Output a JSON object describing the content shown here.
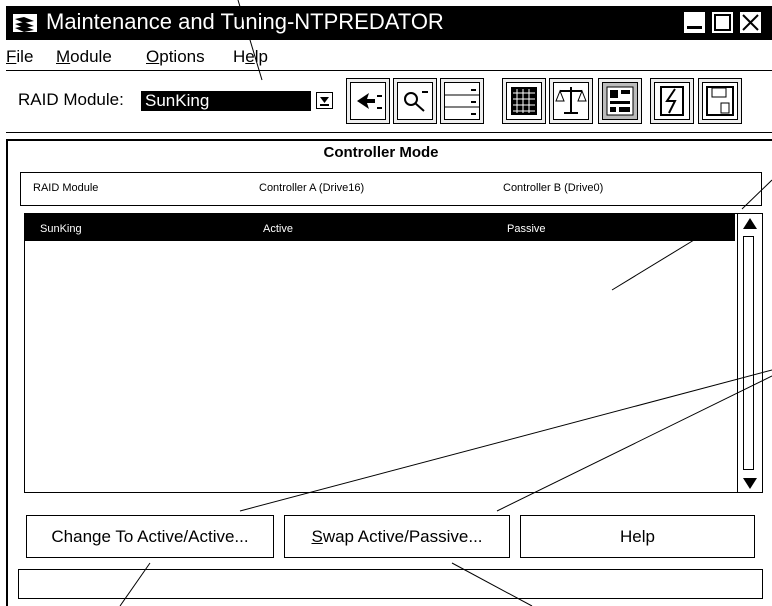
{
  "window": {
    "title": "Maintenance and Tuning-NTPREDATOR",
    "controls": [
      "minimize",
      "maximize",
      "close"
    ]
  },
  "menu": {
    "items": [
      {
        "pre": "",
        "u": "F",
        "post": "ile"
      },
      {
        "pre": "",
        "u": "M",
        "post": "odule"
      },
      {
        "pre": "",
        "u": "O",
        "post": "ptions"
      },
      {
        "pre": "H",
        "u": "e",
        "post": "lp"
      }
    ]
  },
  "toolbar": {
    "raid_label": "RAID Module:",
    "raid_value": "SunKing",
    "icons": [
      "configuration-icon",
      "status-icon",
      "recovery-icon",
      "maintenance-icon",
      "balance-icon",
      "controller-icon",
      "firmware-icon",
      "save-icon"
    ]
  },
  "panel": {
    "title": "Controller Mode",
    "headers": [
      "RAID Module",
      "Controller A (Drive16)",
      "Controller B (Drive0)"
    ],
    "rows": [
      {
        "module": "SunKing",
        "a": "Active",
        "b": "Passive"
      }
    ]
  },
  "buttons": {
    "change": {
      "pre": "Chan",
      "u": "g",
      "post": "e To Active/Active..."
    },
    "swap": {
      "pre": "",
      "u": "S",
      "post": "wap Active/Passive..."
    },
    "help": "Help"
  },
  "colors": {
    "fg": "#000000",
    "bg": "#ffffff"
  }
}
